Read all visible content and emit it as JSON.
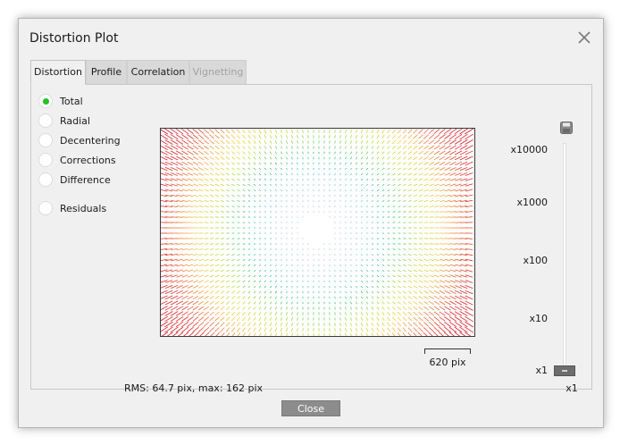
{
  "dialog": {
    "title": "Distortion Plot",
    "close_label": "Close"
  },
  "tabs": [
    {
      "label": "Distortion",
      "state": "active"
    },
    {
      "label": "Profile",
      "state": "normal"
    },
    {
      "label": "Correlation",
      "state": "normal"
    },
    {
      "label": "Vignetting",
      "state": "disabled"
    }
  ],
  "options": [
    {
      "label": "Total",
      "checked": true
    },
    {
      "label": "Radial",
      "checked": false
    },
    {
      "label": "Decentering",
      "checked": false
    },
    {
      "label": "Corrections",
      "checked": false
    },
    {
      "label": "Difference",
      "checked": false
    },
    {
      "label": "Residuals",
      "checked": false
    }
  ],
  "plot": {
    "scalebar_label": "620 pix",
    "stats": "RMS: 64.7 pix, max: 162 pix"
  },
  "zoom": {
    "levels": [
      "x10000",
      "x1000",
      "x100",
      "x10",
      "x1"
    ],
    "selected": "x1",
    "value_label": "x1"
  },
  "icons": {
    "close": "close-icon",
    "save": "save-icon"
  },
  "colors": {
    "selected_radio": "#22c22c",
    "button_bg": "#8c8c8c"
  }
}
